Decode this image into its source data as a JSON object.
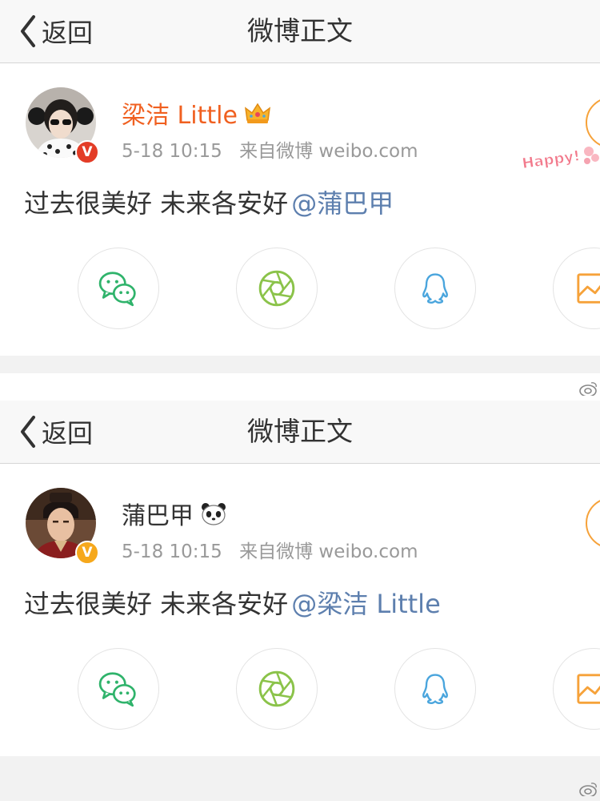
{
  "colors": {
    "navbar_bg": "#f8f8f8",
    "page_bg": "#f2f2f2",
    "vip_name": "#f06020",
    "mention": "#5d7fae",
    "meta_text": "#999999",
    "wechat": "#2fb36b",
    "moments": "#8bc34a",
    "qq": "#4aa5dd",
    "image": "#f6a23a",
    "follow_ring": "#f6a23a"
  },
  "panels": [
    {
      "navbar": {
        "back_label": "返回",
        "title": "微博正文"
      },
      "post": {
        "username": "梁洁 Little",
        "username_icon": "crown-icon",
        "verified_icon": "red-verified-icon",
        "date": "5-18 10:15",
        "source": "来自微博 weibo.com",
        "text": "过去很美好 未来各安好",
        "mention": "@蒲巴甲"
      },
      "sticker": "Happy!",
      "share_icons": [
        "wechat-icon",
        "moments-icon",
        "qq-icon",
        "image-icon"
      ]
    },
    {
      "navbar": {
        "back_label": "返回",
        "title": "微博正文"
      },
      "post": {
        "username": "蒲巴甲",
        "username_icon": "panda-icon",
        "verified_icon": "gold-verified-icon",
        "date": "5-18 10:15",
        "source": "来自微博 weibo.com",
        "text": "过去很美好 未来各安好",
        "mention": "@梁洁 Little"
      },
      "share_icons": [
        "wechat-icon",
        "moments-icon",
        "qq-icon",
        "image-icon"
      ]
    }
  ]
}
